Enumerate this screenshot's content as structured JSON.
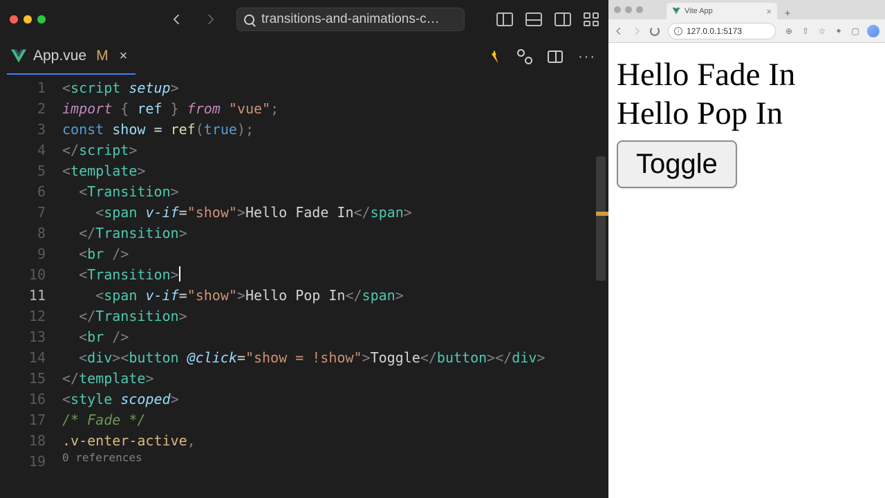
{
  "titlebar": {
    "project_name": "transitions-and-animations-c…"
  },
  "tab": {
    "filename": "App.vue",
    "modified_marker": "M"
  },
  "gutter": {
    "active_line": 11
  },
  "code": [
    {
      "ln": 1,
      "seg": [
        [
          "<",
          "p"
        ],
        [
          "script",
          "t"
        ],
        [
          " ",
          ""
        ],
        [
          "setup",
          "a"
        ],
        [
          ">",
          "p"
        ]
      ]
    },
    {
      "ln": 2,
      "seg": [
        [
          "import",
          "k"
        ],
        [
          " ",
          ""
        ],
        [
          "{ ",
          "p"
        ],
        [
          "ref",
          "i"
        ],
        [
          " }",
          "p"
        ],
        [
          " ",
          ""
        ],
        [
          "from",
          "k"
        ],
        [
          " ",
          ""
        ],
        [
          "\"vue\"",
          "s"
        ],
        [
          ";",
          "p"
        ]
      ]
    },
    {
      "ln": 3,
      "seg": [
        [
          "const",
          "k2"
        ],
        [
          " ",
          ""
        ],
        [
          "show",
          "i"
        ],
        [
          " = ",
          ""
        ],
        [
          "ref",
          "f"
        ],
        [
          "(",
          "p"
        ],
        [
          "true",
          "k2"
        ],
        [
          ")",
          "p"
        ],
        [
          ";",
          "p"
        ]
      ]
    },
    {
      "ln": 4,
      "seg": [
        [
          "</",
          "p"
        ],
        [
          "script",
          "t"
        ],
        [
          ">",
          "p"
        ]
      ]
    },
    {
      "ln": 5,
      "seg": [
        [
          "",
          ""
        ]
      ]
    },
    {
      "ln": 6,
      "seg": [
        [
          "<",
          "p"
        ],
        [
          "template",
          "t"
        ],
        [
          ">",
          "p"
        ]
      ]
    },
    {
      "ln": 7,
      "seg": [
        [
          "  <",
          "p"
        ],
        [
          "Transition",
          "t"
        ],
        [
          ">",
          "p"
        ]
      ]
    },
    {
      "ln": 8,
      "seg": [
        [
          "    <",
          "p"
        ],
        [
          "span",
          "t"
        ],
        [
          " ",
          ""
        ],
        [
          "v-if",
          "a"
        ],
        [
          "=",
          ""
        ],
        [
          "\"show\"",
          "s"
        ],
        [
          ">",
          "p"
        ],
        [
          "Hello Fade In",
          "x"
        ],
        [
          "</",
          "p"
        ],
        [
          "span",
          "t"
        ],
        [
          ">",
          "p"
        ]
      ]
    },
    {
      "ln": 9,
      "seg": [
        [
          "  </",
          "p"
        ],
        [
          "Transition",
          "t"
        ],
        [
          ">",
          "p"
        ]
      ]
    },
    {
      "ln": 10,
      "seg": [
        [
          "  <",
          "p"
        ],
        [
          "br",
          "t"
        ],
        [
          " />",
          "p"
        ]
      ]
    },
    {
      "ln": 11,
      "seg": [
        [
          "  <",
          "p"
        ],
        [
          "Transition",
          "t"
        ],
        [
          ">",
          "p"
        ]
      ],
      "cursor": true
    },
    {
      "ln": 12,
      "seg": [
        [
          "    <",
          "p"
        ],
        [
          "span",
          "t"
        ],
        [
          " ",
          ""
        ],
        [
          "v-if",
          "a"
        ],
        [
          "=",
          ""
        ],
        [
          "\"show\"",
          "s"
        ],
        [
          ">",
          "p"
        ],
        [
          "Hello Pop In",
          "x"
        ],
        [
          "</",
          "p"
        ],
        [
          "span",
          "t"
        ],
        [
          ">",
          "p"
        ]
      ]
    },
    {
      "ln": 13,
      "seg": [
        [
          "  </",
          "p"
        ],
        [
          "Transition",
          "t"
        ],
        [
          ">",
          "p"
        ]
      ]
    },
    {
      "ln": 14,
      "seg": [
        [
          "  <",
          "p"
        ],
        [
          "br",
          "t"
        ],
        [
          " />",
          "p"
        ]
      ]
    },
    {
      "ln": 15,
      "seg": [
        [
          "  <",
          "p"
        ],
        [
          "div",
          "t"
        ],
        [
          "><",
          "p"
        ],
        [
          "button",
          "t"
        ],
        [
          " ",
          ""
        ],
        [
          "@click",
          "a"
        ],
        [
          "=",
          ""
        ],
        [
          "\"show = !show\"",
          "s"
        ],
        [
          ">",
          "p"
        ],
        [
          "Toggle",
          "x"
        ],
        [
          "</",
          "p"
        ],
        [
          "button",
          "t"
        ],
        [
          "></",
          "p"
        ],
        [
          "div",
          "t"
        ],
        [
          ">",
          "p"
        ]
      ]
    },
    {
      "ln": 16,
      "seg": [
        [
          "</",
          "p"
        ],
        [
          "template",
          "t"
        ],
        [
          ">",
          "p"
        ]
      ]
    },
    {
      "ln": 17,
      "seg": [
        [
          "<",
          "p"
        ],
        [
          "style",
          "t"
        ],
        [
          " ",
          ""
        ],
        [
          "scoped",
          "a"
        ],
        [
          ">",
          "p"
        ]
      ]
    },
    {
      "ln": 18,
      "seg": [
        [
          "/* Fade */",
          "c"
        ]
      ]
    },
    {
      "ln": 19,
      "seg": [
        [
          ".v-enter-active",
          "sel"
        ],
        [
          ",",
          "p"
        ]
      ]
    }
  ],
  "refs_hint": "0 references",
  "colors": {
    "traffic_close": "#ff5f57",
    "traffic_min": "#febc2e",
    "traffic_max": "#28c840"
  },
  "browser": {
    "tab_title": "Vite App",
    "url": "127.0.0.1:5173",
    "page": {
      "line1": "Hello Fade In",
      "line2": "Hello Pop In",
      "button": "Toggle"
    }
  }
}
